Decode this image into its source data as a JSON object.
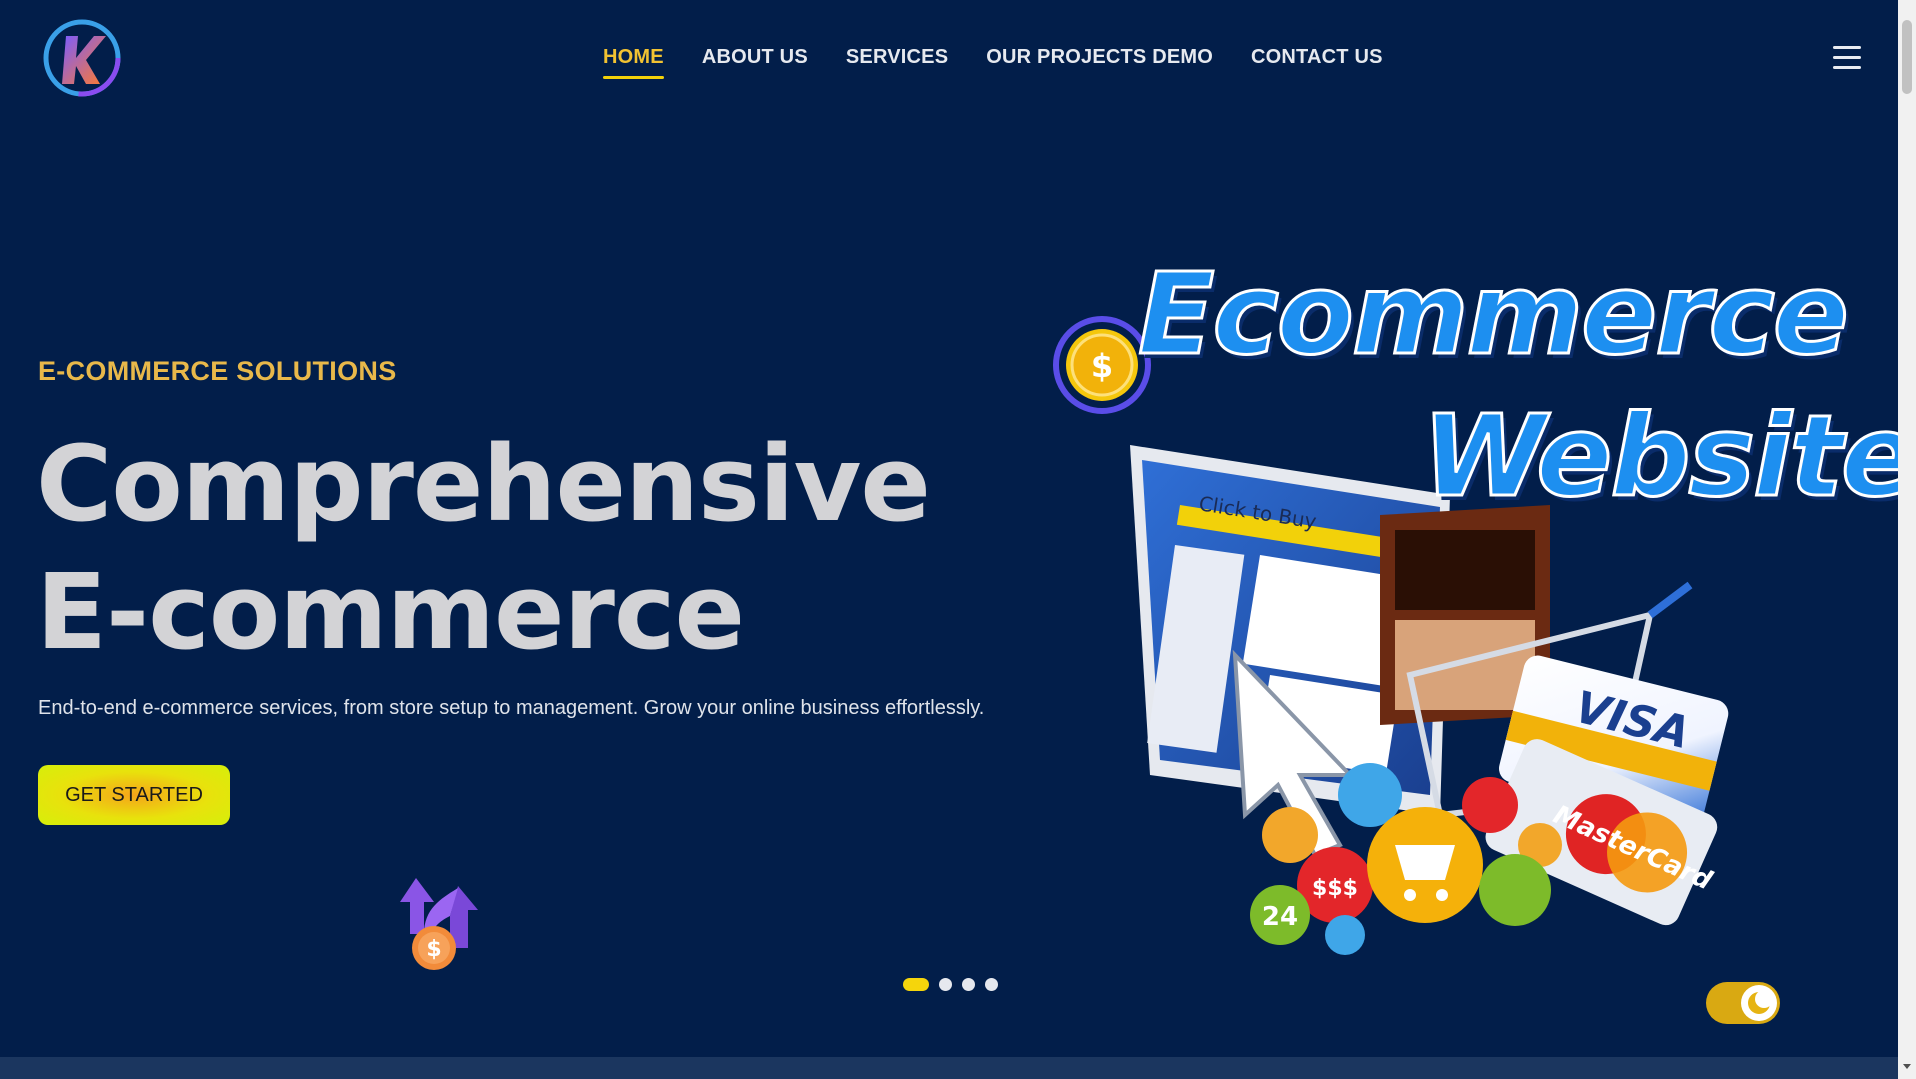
{
  "nav": {
    "items": [
      {
        "label": "HOME",
        "active": true
      },
      {
        "label": "ABOUT US",
        "active": false
      },
      {
        "label": "SERVICES",
        "active": false
      },
      {
        "label": "OUR PROJECTS DEMO",
        "active": false
      },
      {
        "label": "CONTACT US",
        "active": false
      }
    ],
    "menu_icon": "hamburger-icon",
    "active_color": "#f1c232"
  },
  "hero": {
    "eyebrow": "E-COMMERCE SOLUTIONS",
    "headline_line1": "Comprehensive",
    "headline_line2": "E-commerce",
    "description": "End-to-end e-commerce services, from store setup to management. Grow your online business effortlessly.",
    "cta_label": "GET STARTED",
    "image_text_1": "Ecommerce",
    "image_text_2": "Website",
    "visa_label": "VISA",
    "mastercard_label": "MasterCard",
    "badge_text": "$$$",
    "badge_24": "24",
    "site_brand": "Click to Buy"
  },
  "slider": {
    "slide_count": 4,
    "active_index": 0
  },
  "theme_toggle": {
    "icon": "moon-icon",
    "on": true
  },
  "colors": {
    "background": "#021e4a",
    "accent": "#f1c232",
    "cta_yellow": "#e8e20c",
    "headline": "#d3d3d6"
  }
}
